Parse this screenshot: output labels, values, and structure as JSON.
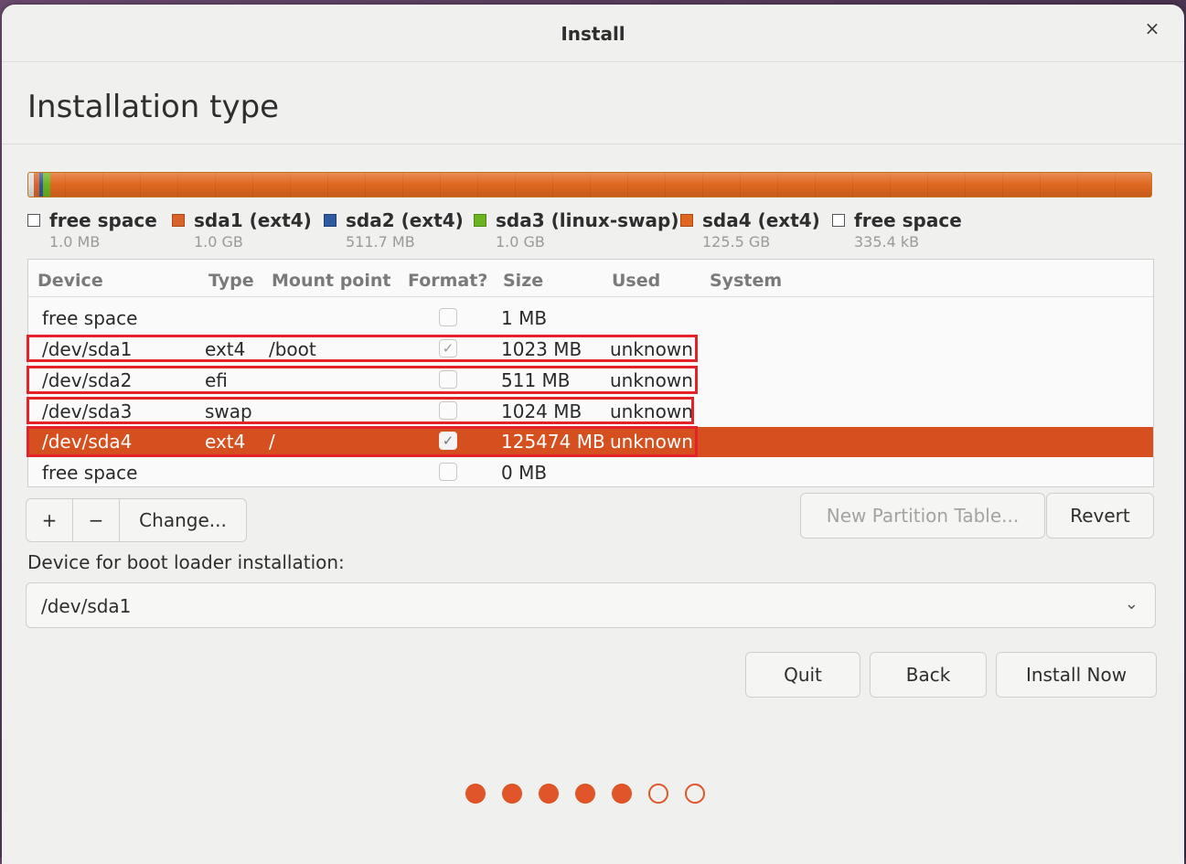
{
  "window": {
    "title": "Install",
    "close_glyph": "×"
  },
  "page": {
    "heading": "Installation type"
  },
  "partition_bar": {
    "segments": [
      {
        "name": "free space",
        "color": "#e8e8e8"
      },
      {
        "name": "sda1 (ext4)",
        "color": "#d9632a"
      },
      {
        "name": "sda2 (ext4)",
        "color": "#2d5aa0"
      },
      {
        "name": "sda3 (linux-swap)",
        "color": "#6bb31f"
      },
      {
        "name": "sda4 (ext4)",
        "color": "#e0671f"
      },
      {
        "name": "free space",
        "color": "#ffffff"
      }
    ]
  },
  "legend": [
    {
      "name": "free space",
      "size": "1.0 MB",
      "color": "#ffffff",
      "outlined": true
    },
    {
      "name": "sda1 (ext4)",
      "size": "1.0 GB",
      "color": "#d9632a",
      "outlined": false
    },
    {
      "name": "sda2 (ext4)",
      "size": "511.7 MB",
      "color": "#2d5aa0",
      "outlined": false
    },
    {
      "name": "sda3 (linux-swap)",
      "size": "1.0 GB",
      "color": "#6bb31f",
      "outlined": false
    },
    {
      "name": "sda4 (ext4)",
      "size": "125.5 GB",
      "color": "#e0671f",
      "outlined": false
    },
    {
      "name": "free space",
      "size": "335.4 kB",
      "color": "#ffffff",
      "outlined": true
    }
  ],
  "table": {
    "columns": [
      "Device",
      "Type",
      "Mount point",
      "Format?",
      "Size",
      "Used",
      "System"
    ],
    "rows": [
      {
        "device": "free space",
        "type": "",
        "mount": "",
        "format": false,
        "size": "1 MB",
        "used": "",
        "system": ""
      },
      {
        "device": "/dev/sda1",
        "type": "ext4",
        "mount": "/boot",
        "format": true,
        "size": "1023 MB",
        "used": "unknown",
        "system": ""
      },
      {
        "device": "/dev/sda2",
        "type": "efi",
        "mount": "",
        "format": false,
        "size": "511 MB",
        "used": "unknown",
        "system": ""
      },
      {
        "device": "/dev/sda3",
        "type": "swap",
        "mount": "",
        "format": false,
        "size": "1024 MB",
        "used": "unknown",
        "system": ""
      },
      {
        "device": "/dev/sda4",
        "type": "ext4",
        "mount": "/",
        "format": true,
        "size": "125474 MB",
        "used": "unknown",
        "system": "",
        "selected": true
      },
      {
        "device": "free space",
        "type": "",
        "mount": "",
        "format": false,
        "size": "0 MB",
        "used": "",
        "system": ""
      }
    ]
  },
  "toolbar": {
    "add_label": "+",
    "remove_label": "−",
    "change_label": "Change...",
    "new_table_label": "New Partition Table...",
    "revert_label": "Revert"
  },
  "bootloader": {
    "label": "Device for boot loader installation:",
    "value": "/dev/sda1",
    "arrow": "⌄"
  },
  "nav": {
    "quit_label": "Quit",
    "back_label": "Back",
    "install_label": "Install Now"
  },
  "progress": {
    "total_steps": 7,
    "completed_steps": 5
  },
  "check_glyph": "✓",
  "highlight_color": "#e5222a",
  "accent_color": "#d6501f"
}
